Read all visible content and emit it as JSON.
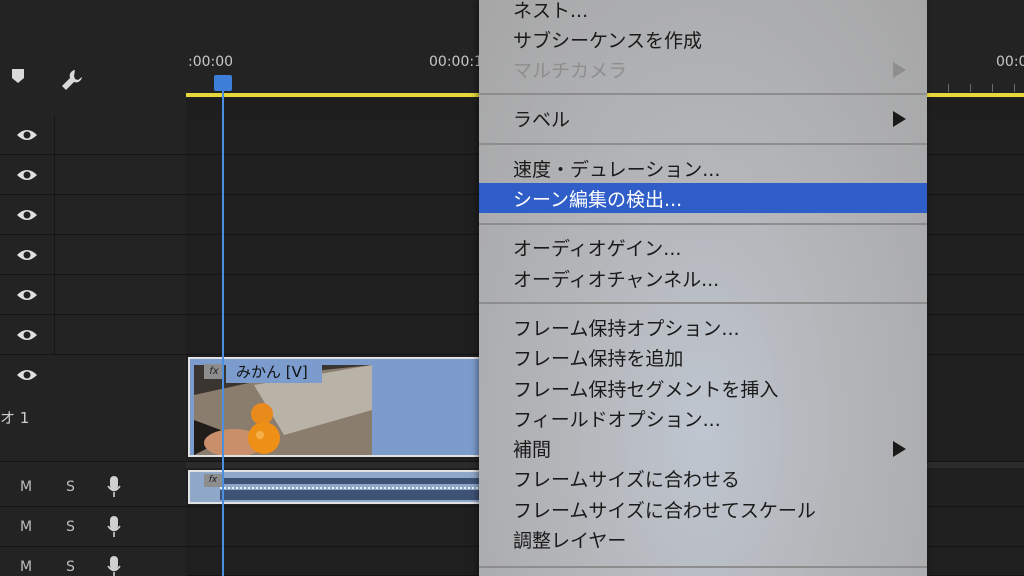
{
  "ruler": {
    "time_start": ":00:00",
    "time_mid": "00:00:1",
    "time_end": "00:0"
  },
  "tracks": {
    "video_track_label": "オ 1",
    "audio_rows": [
      {
        "mute": "M",
        "solo": "S"
      },
      {
        "mute": "M",
        "solo": "S"
      },
      {
        "mute": "M",
        "solo": "S"
      }
    ]
  },
  "clips": {
    "video_clip_name": "みかん [V]",
    "fx_badge": "fx"
  },
  "context_menu": {
    "items": [
      {
        "label": "ネスト...",
        "state": "enabled"
      },
      {
        "label": "サブシーケンスを作成",
        "state": "enabled"
      },
      {
        "label": "マルチカメラ",
        "state": "disabled",
        "submenu": true
      },
      {
        "label": "ラベル",
        "state": "enabled",
        "submenu": true
      },
      {
        "label": "速度・デュレーション...",
        "state": "enabled"
      },
      {
        "label": "シーン編集の検出...",
        "state": "highlighted"
      },
      {
        "label": "オーディオゲイン...",
        "state": "enabled"
      },
      {
        "label": "オーディオチャンネル...",
        "state": "enabled"
      },
      {
        "label": "フレーム保持オプション...",
        "state": "enabled"
      },
      {
        "label": "フレーム保持を追加",
        "state": "enabled"
      },
      {
        "label": "フレーム保持セグメントを挿入",
        "state": "enabled"
      },
      {
        "label": "フィールドオプション...",
        "state": "enabled"
      },
      {
        "label": "補間",
        "state": "enabled",
        "submenu": true
      },
      {
        "label": "フレームサイズに合わせる",
        "state": "enabled"
      },
      {
        "label": "フレームサイズに合わせてスケール",
        "state": "enabled"
      },
      {
        "label": "調整レイヤー",
        "state": "enabled"
      }
    ]
  },
  "colors": {
    "highlight": "#2f5ec8",
    "playhead": "#4a8fe0",
    "work_area_bar": "#e6d83a",
    "video_clip": "#7b9ccd"
  },
  "icons": [
    "marker-icon",
    "wrench-icon",
    "eye-icon",
    "microphone-icon",
    "submenu-arrow-icon"
  ]
}
